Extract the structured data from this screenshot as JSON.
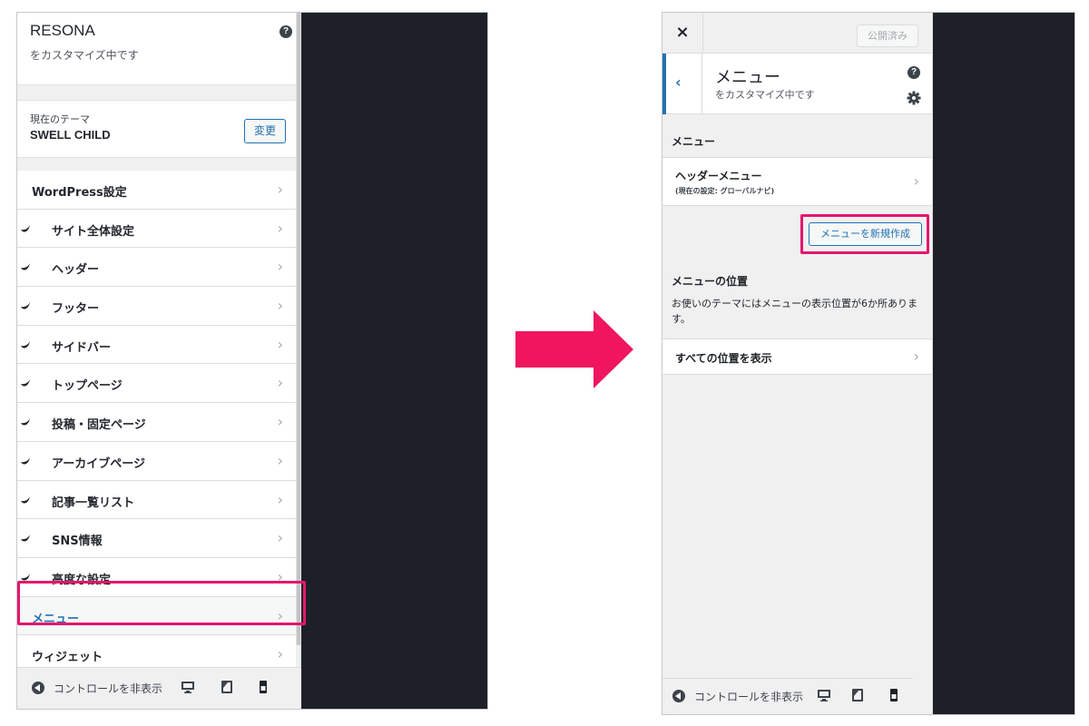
{
  "left": {
    "site_name": "RESONA",
    "customizing": "をカスタマイズ中です",
    "help": "?",
    "theme_label": "現在のテーマ",
    "theme_name": "SWELL CHILD",
    "change_label": "変更",
    "items": [
      {
        "label": "WordPress設定"
      },
      {
        "label": "サイト全体設定"
      },
      {
        "label": "ヘッダー"
      },
      {
        "label": "フッター"
      },
      {
        "label": "サイドバー"
      },
      {
        "label": "トップページ"
      },
      {
        "label": "投稿・固定ページ"
      },
      {
        "label": "アーカイブページ"
      },
      {
        "label": "記事一覧リスト"
      },
      {
        "label": "SNS情報"
      },
      {
        "label": "高度な設定"
      },
      {
        "label": "メニュー"
      },
      {
        "label": "ウィジェット"
      }
    ],
    "chevron": "›",
    "footer_text": "コントロールを非表示"
  },
  "right": {
    "close": "×",
    "publish_label": "公開済み",
    "back": "‹",
    "title": "メニュー",
    "customizing": "をカスタマイズ中です",
    "help": "?",
    "section_menus": "メニュー",
    "header_menu": "ヘッダーメニュー",
    "header_menu_current": "(現在の設定: グローバルナビ)",
    "new_menu_label": "メニューを新規作成",
    "section_locations": "メニューの位置",
    "locations_desc": "お使いのテーマにはメニューの表示位置が6か所あります。",
    "view_all": "すべての位置を表示",
    "chevron": "›",
    "footer_text": "コントロールを非表示"
  },
  "colors": {
    "accent": "#2271b1",
    "highlight": "#e5166b",
    "preview_bg": "#1d2027",
    "panel_bg": "#f0f0f1"
  },
  "icons": [
    "help-icon",
    "swell-icon",
    "chevron-right-icon",
    "collapse-icon",
    "desktop-icon",
    "tablet-icon",
    "mobile-icon",
    "close-icon",
    "back-icon",
    "gear-icon",
    "arrow-right-icon"
  ]
}
